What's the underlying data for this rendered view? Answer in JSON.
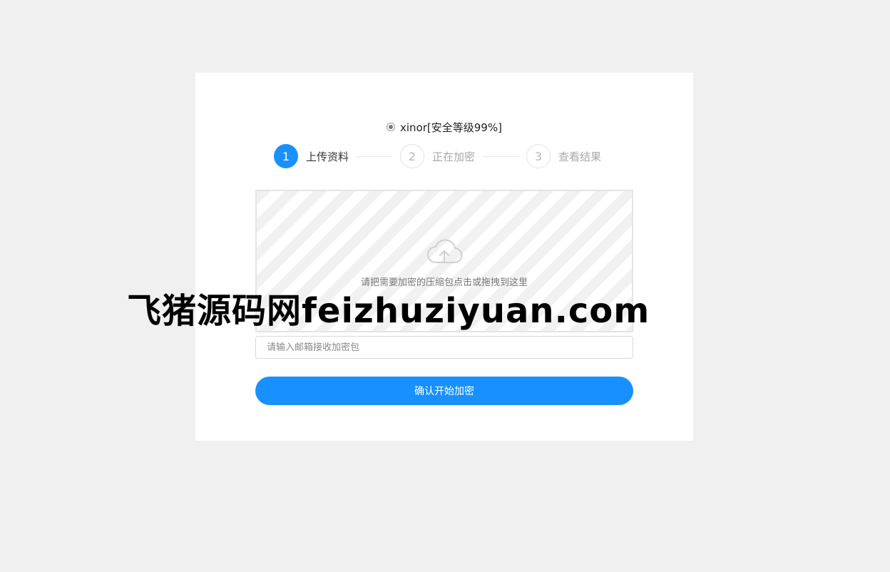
{
  "option": {
    "label": "xinor[安全等级99%]",
    "selected": true
  },
  "steps": [
    {
      "number": "1",
      "label": "上传资料",
      "active": true
    },
    {
      "number": "2",
      "label": "正在加密",
      "active": false
    },
    {
      "number": "3",
      "label": "查看结果",
      "active": false
    }
  ],
  "upload": {
    "icon": "cloud-upload-icon",
    "hint": "请把需要加密的压缩包点击或拖拽到这里"
  },
  "email": {
    "placeholder": "请输入邮箱接收加密包",
    "value": ""
  },
  "submit": {
    "label": "确认开始加密"
  },
  "watermark": {
    "text": "飞猪源码网feizhuziyuan.com"
  },
  "colors": {
    "accent": "#1890ff",
    "background": "#f0f0f0",
    "card": "#ffffff"
  }
}
